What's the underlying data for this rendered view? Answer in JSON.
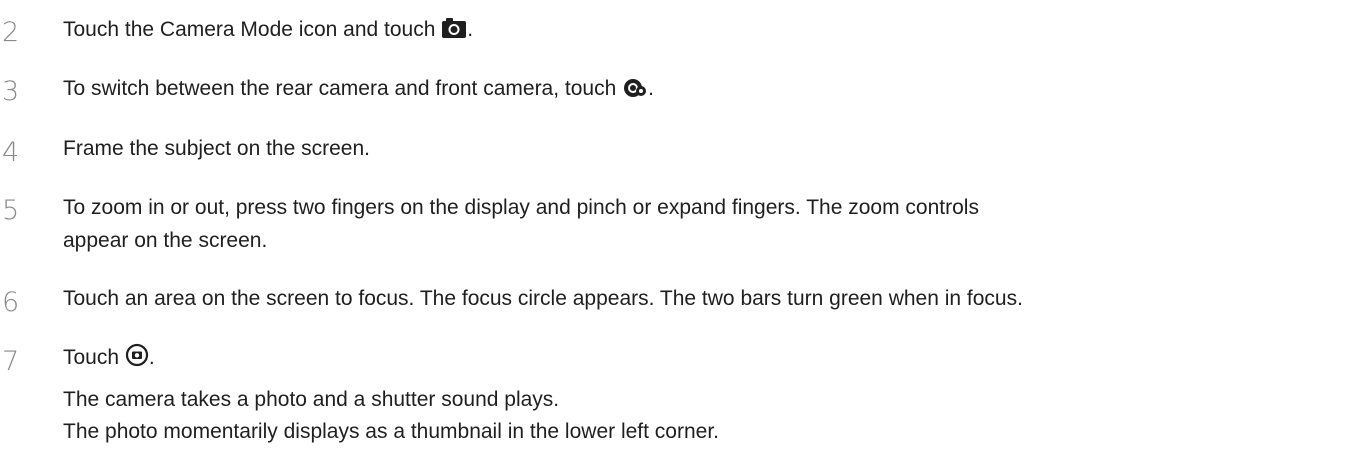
{
  "steps": [
    {
      "number": "2",
      "text_before": "Touch the Camera Mode icon and touch ",
      "icon": "camera-icon",
      "text_after": "."
    },
    {
      "number": "3",
      "text_before": "To switch between the rear camera and front camera, touch ",
      "icon": "switch-camera-icon",
      "text_after": "."
    },
    {
      "number": "4",
      "text": "Frame the subject on the screen."
    },
    {
      "number": "5",
      "line1": "To zoom in or out, press two fingers on the display and pinch or expand fingers. The zoom controls",
      "line2": "appear on the screen."
    },
    {
      "number": "6",
      "text": "Touch an area on the screen to focus. The focus circle appears. The two bars turn green when in focus."
    },
    {
      "number": "7",
      "text_before": "Touch ",
      "icon": "shutter-icon",
      "text_after": ".",
      "notes": [
        "The camera takes a photo and a shutter sound plays.",
        "The photo momentarily displays as a thumbnail in the lower left corner."
      ]
    }
  ]
}
